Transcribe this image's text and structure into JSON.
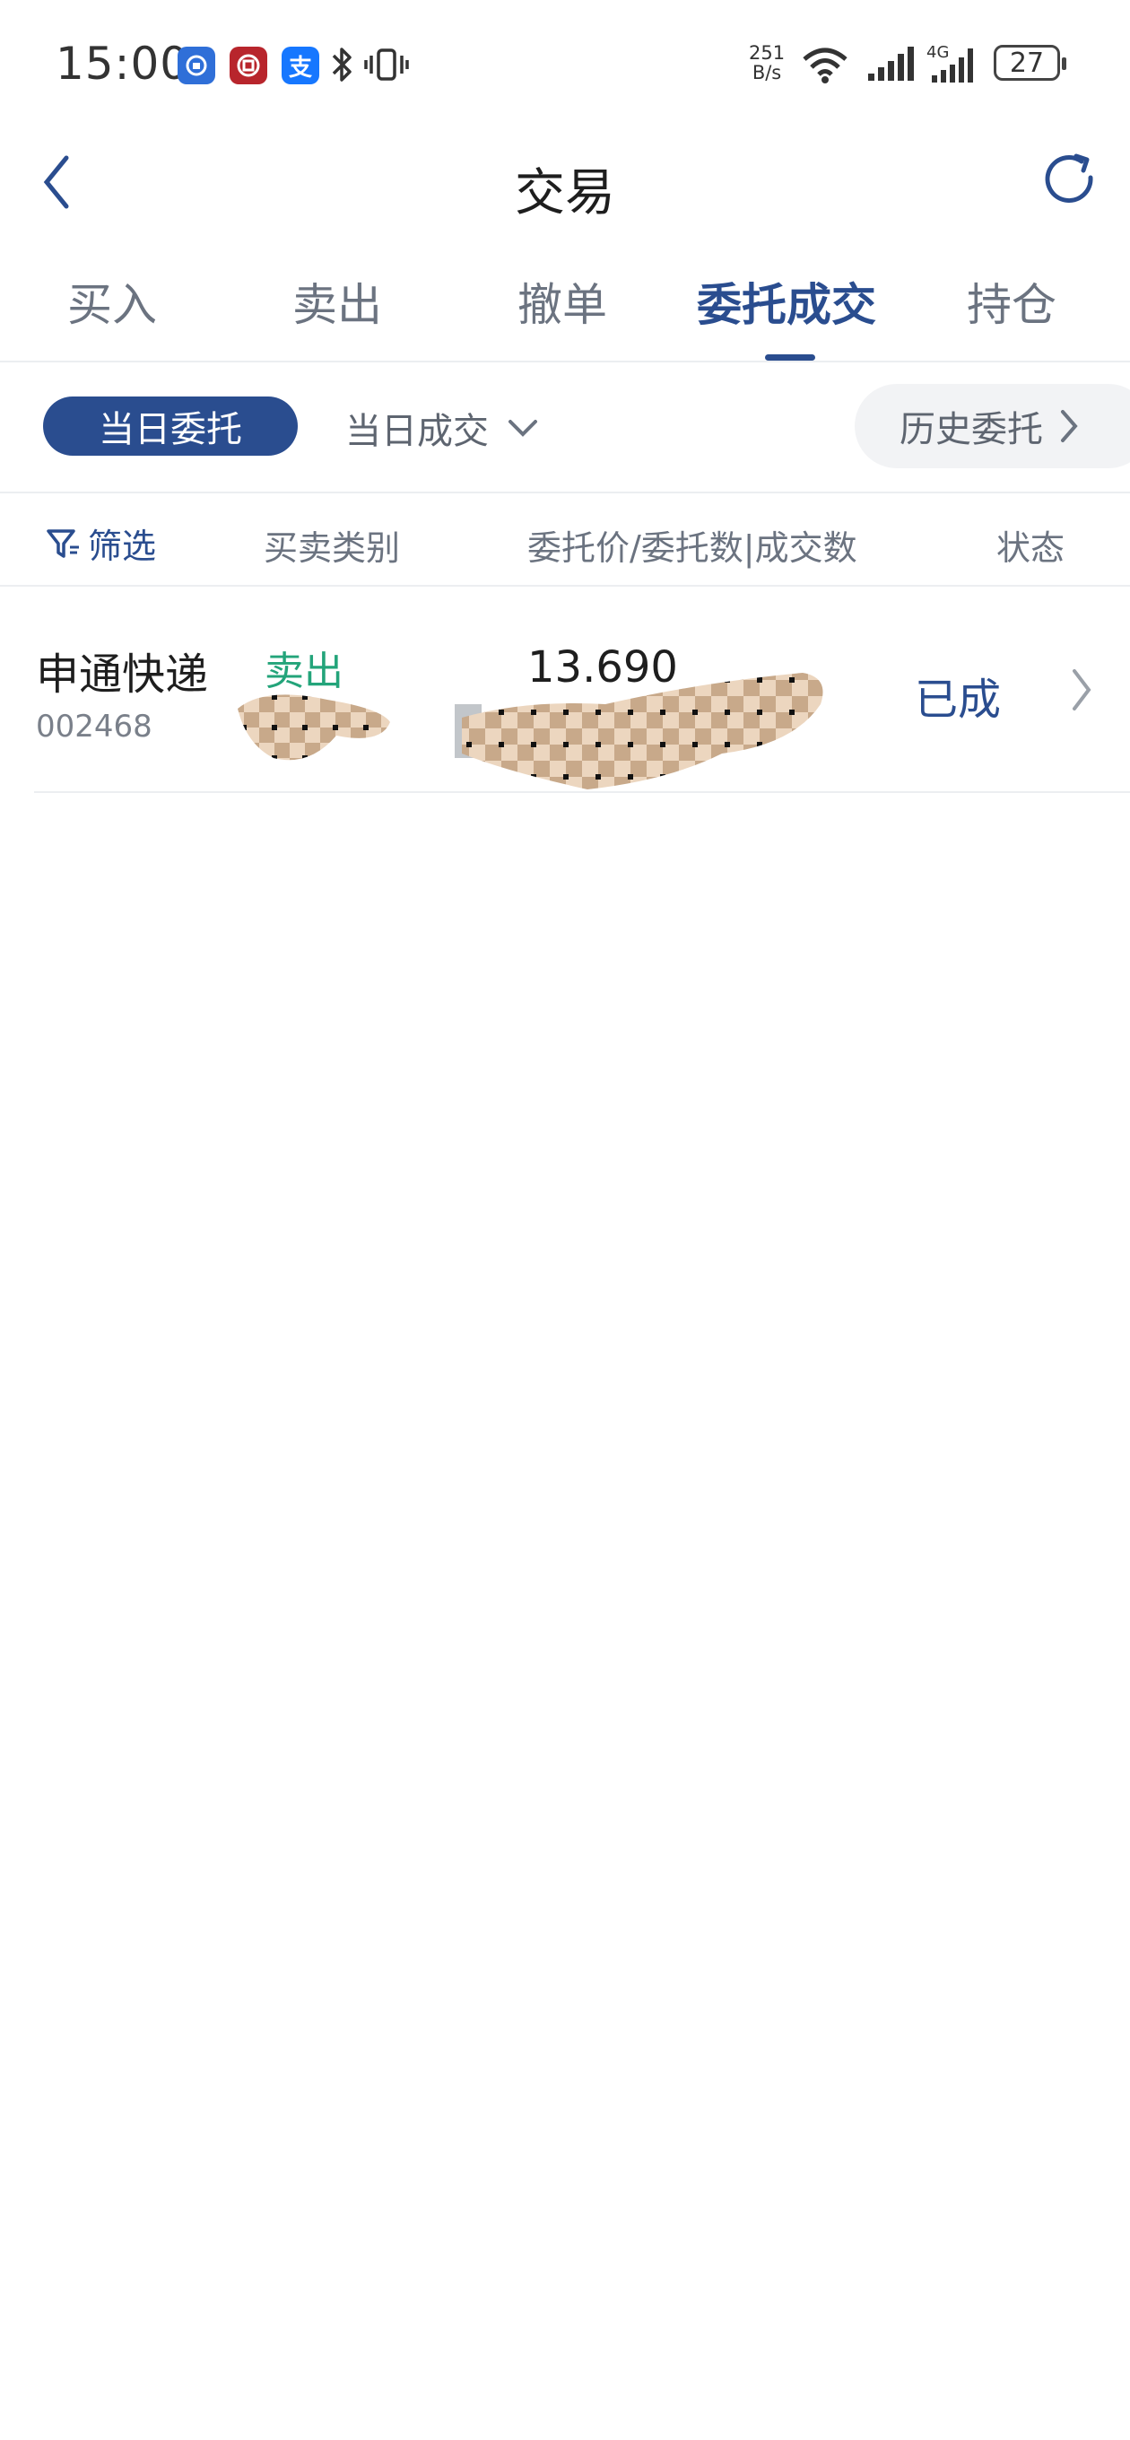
{
  "status_bar": {
    "time": "15:00",
    "net_speed_top": "251",
    "net_speed_bottom": "B/s",
    "battery": "27",
    "app_icons": [
      "bank-icon",
      "bank-of-china-icon",
      "alipay-icon"
    ],
    "alipay_glyph": "支"
  },
  "header": {
    "title": "交易"
  },
  "tabs": [
    {
      "label": "买入"
    },
    {
      "label": "卖出"
    },
    {
      "label": "撤单"
    },
    {
      "label": "委托成交",
      "active": true
    },
    {
      "label": "持仓"
    }
  ],
  "filters": {
    "today_orders": "当日委托",
    "today_deals": "当日成交",
    "history_orders": "历史委托"
  },
  "columns": {
    "filter": "筛选",
    "type": "买卖类别",
    "price_qty": "委托价/委托数|成交数",
    "status": "状态"
  },
  "orders": [
    {
      "name": "申通快递",
      "code": "002468",
      "side": "卖出",
      "price": "13.690",
      "status": "已成"
    }
  ],
  "colors": {
    "primary": "#2a4d8f",
    "sell_green": "#23a47a",
    "text_muted": "#6b7380"
  }
}
